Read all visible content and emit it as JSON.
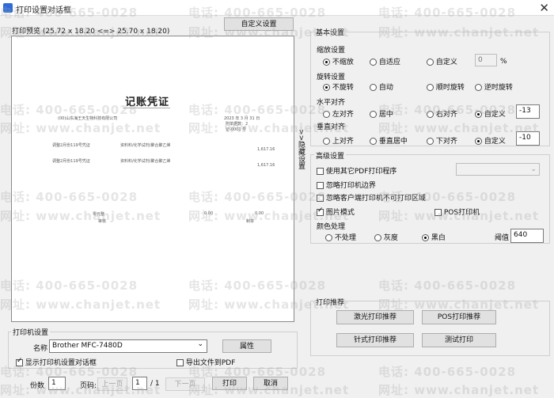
{
  "window": {
    "title": "打印设置对话框",
    "close": "✕"
  },
  "preview": {
    "label": "打印预览 (25.72 x 18.20 <=> 25.70 x 18.20)",
    "custom_settings_button": "自定义设置",
    "toggle_panel": ">>隐藏设置",
    "doc": {
      "title": "记账凭证",
      "company": "(00)山东海王天生物科技有限公司",
      "date": "2023 年 3 月 31 日",
      "attach": "附单据数：2",
      "voucher_no": "记-0001 号",
      "row1_summary": "调整2月份119号凭证",
      "row1_account": "资料料/化学试剂/聚合聚乙烯",
      "row1_amount": "1,617.16",
      "row2_summary": "调整2月份119号凭证",
      "row2_account": "资料料/化学试剂/聚合聚乙烯",
      "row2_amount": "1,617.16",
      "footer_label": "零元整",
      "footer_amount": "0.00",
      "footer_total": "0.00",
      "sign1": "审核",
      "sign2": "制单"
    }
  },
  "basic": {
    "title": "基本设置",
    "scale": {
      "label": "缩放设置",
      "options": [
        "不缩放",
        "自适应",
        "自定义"
      ],
      "selected": 0,
      "value": "0",
      "unit": "%"
    },
    "rotate": {
      "label": "旋转设置",
      "options": [
        "不旋转",
        "自动",
        "顺时旋转",
        "逆时旋转"
      ],
      "selected": 0
    },
    "halign": {
      "label": "水平对齐",
      "options": [
        "左对齐",
        "居中",
        "右对齐",
        "自定义"
      ],
      "selected": 3,
      "value": "-13"
    },
    "valign": {
      "label": "垂直对齐",
      "options": [
        "上对齐",
        "垂直居中",
        "下对齐",
        "自定义"
      ],
      "selected": 3,
      "value": "-10"
    }
  },
  "advanced": {
    "title": "高级设置",
    "use_pdf": {
      "label": "使用其它PDF打印程序",
      "checked": false
    },
    "ignore_margin": {
      "label": "忽略打印机边界",
      "checked": false
    },
    "ignore_unprintable": {
      "label": "忽略客户端打印机不可打印区域",
      "checked": false
    },
    "image_mode": {
      "label": "图片模式",
      "checked": true
    },
    "pos_printer": {
      "label": "POS打印机",
      "checked": false
    },
    "color": {
      "label": "颜色处理",
      "options": [
        "不处理",
        "灰度",
        "黑白"
      ],
      "selected": 2,
      "threshold_label": "阈值",
      "threshold": "640"
    }
  },
  "recommend": {
    "title": "打印推荐",
    "laser": "激光打印推荐",
    "pos": "POS打印推荐",
    "dot": "针式打印推荐",
    "test": "测试打印"
  },
  "printer": {
    "title": "打印机设置",
    "name_label": "名称",
    "name_value": "Brother MFC-7480D",
    "properties": "属性",
    "show_dialog": {
      "label": "显示打印机设置对话框",
      "checked": true
    },
    "export_pdf": {
      "label": "导出文件到PDF",
      "checked": false
    }
  },
  "bottom": {
    "copies_label": "份数",
    "copies": "1",
    "page_label": "页码:",
    "prev": "上一页",
    "page": "1",
    "of": "/ 1",
    "next": "下一页",
    "print": "打印",
    "cancel": "取消"
  },
  "watermark": {
    "phone": "电话: 400-665-0028",
    "site": "网址: www.chanjet.net"
  }
}
